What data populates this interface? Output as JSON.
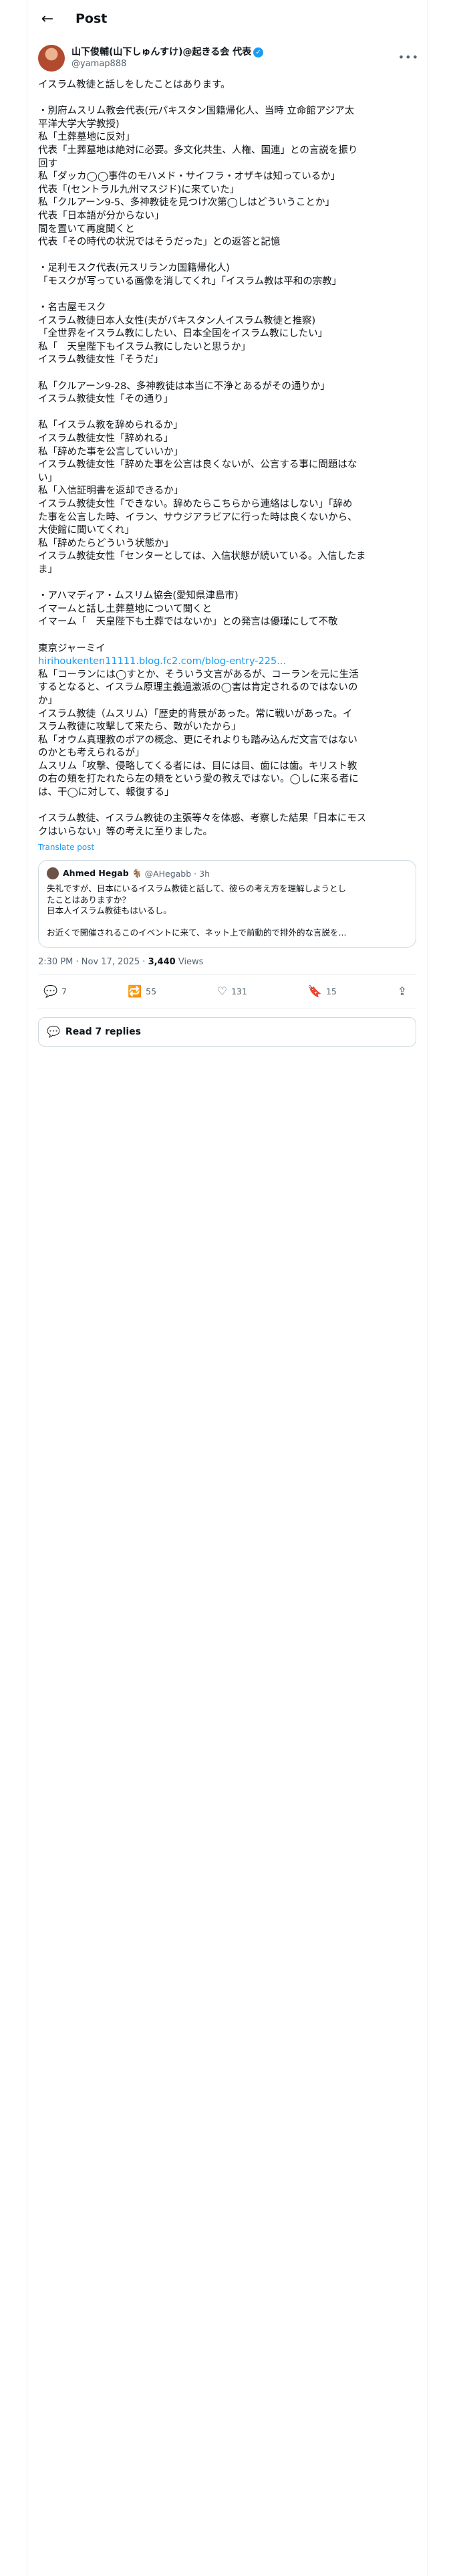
{
  "header": {
    "back_icon": "arrow-left-icon",
    "title": "Post"
  },
  "author": {
    "display_name": "山下俊輔(山下しゅんすけ)@起きる会 代表",
    "verified_mark": "✓",
    "handle": "@yamap888",
    "more": "•••"
  },
  "tweet_lines": [
    "イスラム教徒と話しをしたことはあります。",
    "",
    "・別府ムスリム教会代表(元パキスタン国籍帰化人、当時 立命館アジア太",
    "平洋大学大学教授)",
    "私「土葬墓地に反対」",
    "代表「土葬墓地は絶対に必要。多文化共生、人権、国連」との言説を振り",
    "回す",
    "私「ダッカ◯◯事件のモハメド・サイフラ・オザキは知っているか」",
    "代表「(セントラル九州マスジド)に来ていた」",
    "私「クルアーン9-5、多神教徒を見つけ次第◯しはどういうことか」",
    "代表「日本語が分からない」",
    "間を置いて再度聞くと",
    "代表「その時代の状況ではそうだった」との返答と記憶",
    "",
    "・足利モスク代表(元スリランカ国籍帰化人)",
    "「モスクが写っている画像を消してくれ」「イスラム教は平和の宗教」",
    "",
    "・名古屋モスク",
    "イスラム教徒日本人女性(夫がパキスタン人イスラム教徒と推察)",
    "「全世界をイスラム教にしたい、日本全国をイスラム教にしたい」",
    "私「　天皇陛下もイスラム教にしたいと思うか」",
    "イスラム教徒女性「そうだ」",
    "",
    "私「クルアーン9-28、多神教徒は本当に不浄とあるがその通りか」",
    "イスラム教徒女性「その通り」",
    "",
    "私「イスラム教を辞められるか」",
    "イスラム教徒女性「辞めれる」",
    "私「辞めた事を公言していいか」",
    "イスラム教徒女性「辞めた事を公言は良くないが、公言する事に問題はな",
    "い」",
    "私「入信証明書を返却できるか」",
    "イスラム教徒女性「できない。辞めたらこちらから連絡はしない」「辞め",
    "た事を公言した時、イラン、サウジアラビアに行った時は良くないから、",
    "大使館に聞いてくれ」",
    "私「辞めたらどういう状態か」",
    "イスラム教徒女性「センターとしては、入信状態が続いている。入信したま",
    "ま」",
    "",
    "・アハマディア・ムスリム協会(愛知県津島市)",
    "イマームと話し土葬墓地について聞くと",
    "イマーム「　天皇陛下も土葬ではないか」との発言は優瑾にして不敬",
    "",
    "東京ジャーミイ",
    "",
    "私「コーランには◯すとか、そういう文言があるが、コーランを元に生活",
    "するとなると、イスラム原理主義過激派の◯害は肯定されるのではないの",
    "か」",
    "イスラム教徒（ムスリム）「歴史的背景があった。常に戦いがあった。イ",
    "スラム教徒に攻撃して来たら、敵がいたから」",
    "私「オウム真理教のポアの概念、更にそれよりも踏み込んだ文言ではない",
    "のかとも考えられるが」",
    "ムスリム「攻撃、侵略してくる者には、目には目、歯には歯。キリスト教",
    "の右の頬を打たれたら左の頬をという愛の教えではない。◯しに来る者に",
    "は、干◯に対して、報復する」",
    "",
    "イスラム教徒、イスラム教徒の主張等々を体感、考察した結果「日本にモス",
    "クはいらない」等の考えに至りました。"
  ],
  "tweet_link": "hirihoukenten11111.blog.fc2.com/blog-entry-225...",
  "translate_label": "Translate post",
  "quote": {
    "name": "Ahmed Hegab 🐐",
    "handle": "@AHegabb",
    "dot": "·",
    "time": "3h",
    "lines": [
      "失礼ですが、日本にいるイスラム教徒と話して、彼らの考え方を理解しようとし",
      "たことはありますか？",
      "日本人イスラム教徒もはいるし。",
      "",
      "お近くで開催されるこのイベントに来て、ネット上で前動的で排外的な言説を..."
    ]
  },
  "meta": {
    "time": "2:30 PM · Nov 17, 2025 · ",
    "views_count": "3,440",
    "views_label": " Views"
  },
  "actions": {
    "reply": {
      "icon": "reply-icon",
      "glyph": "💬",
      "count": "7"
    },
    "repost": {
      "icon": "repost-icon",
      "glyph": "🔁",
      "count": "55"
    },
    "like": {
      "icon": "heart-icon",
      "glyph": "♡",
      "count": "131"
    },
    "bookmark": {
      "icon": "bookmark-icon",
      "glyph": "🔖",
      "count": "15"
    },
    "share": {
      "icon": "share-icon",
      "glyph": "⇪"
    }
  },
  "replies_button": {
    "icon": "speech-bubble-icon",
    "glyph": "💬",
    "label": "Read 7 replies"
  },
  "colors": {
    "accent": "#1d9bf0",
    "text": "#0f1419",
    "muted": "#536471",
    "border": "#cfd9de"
  }
}
